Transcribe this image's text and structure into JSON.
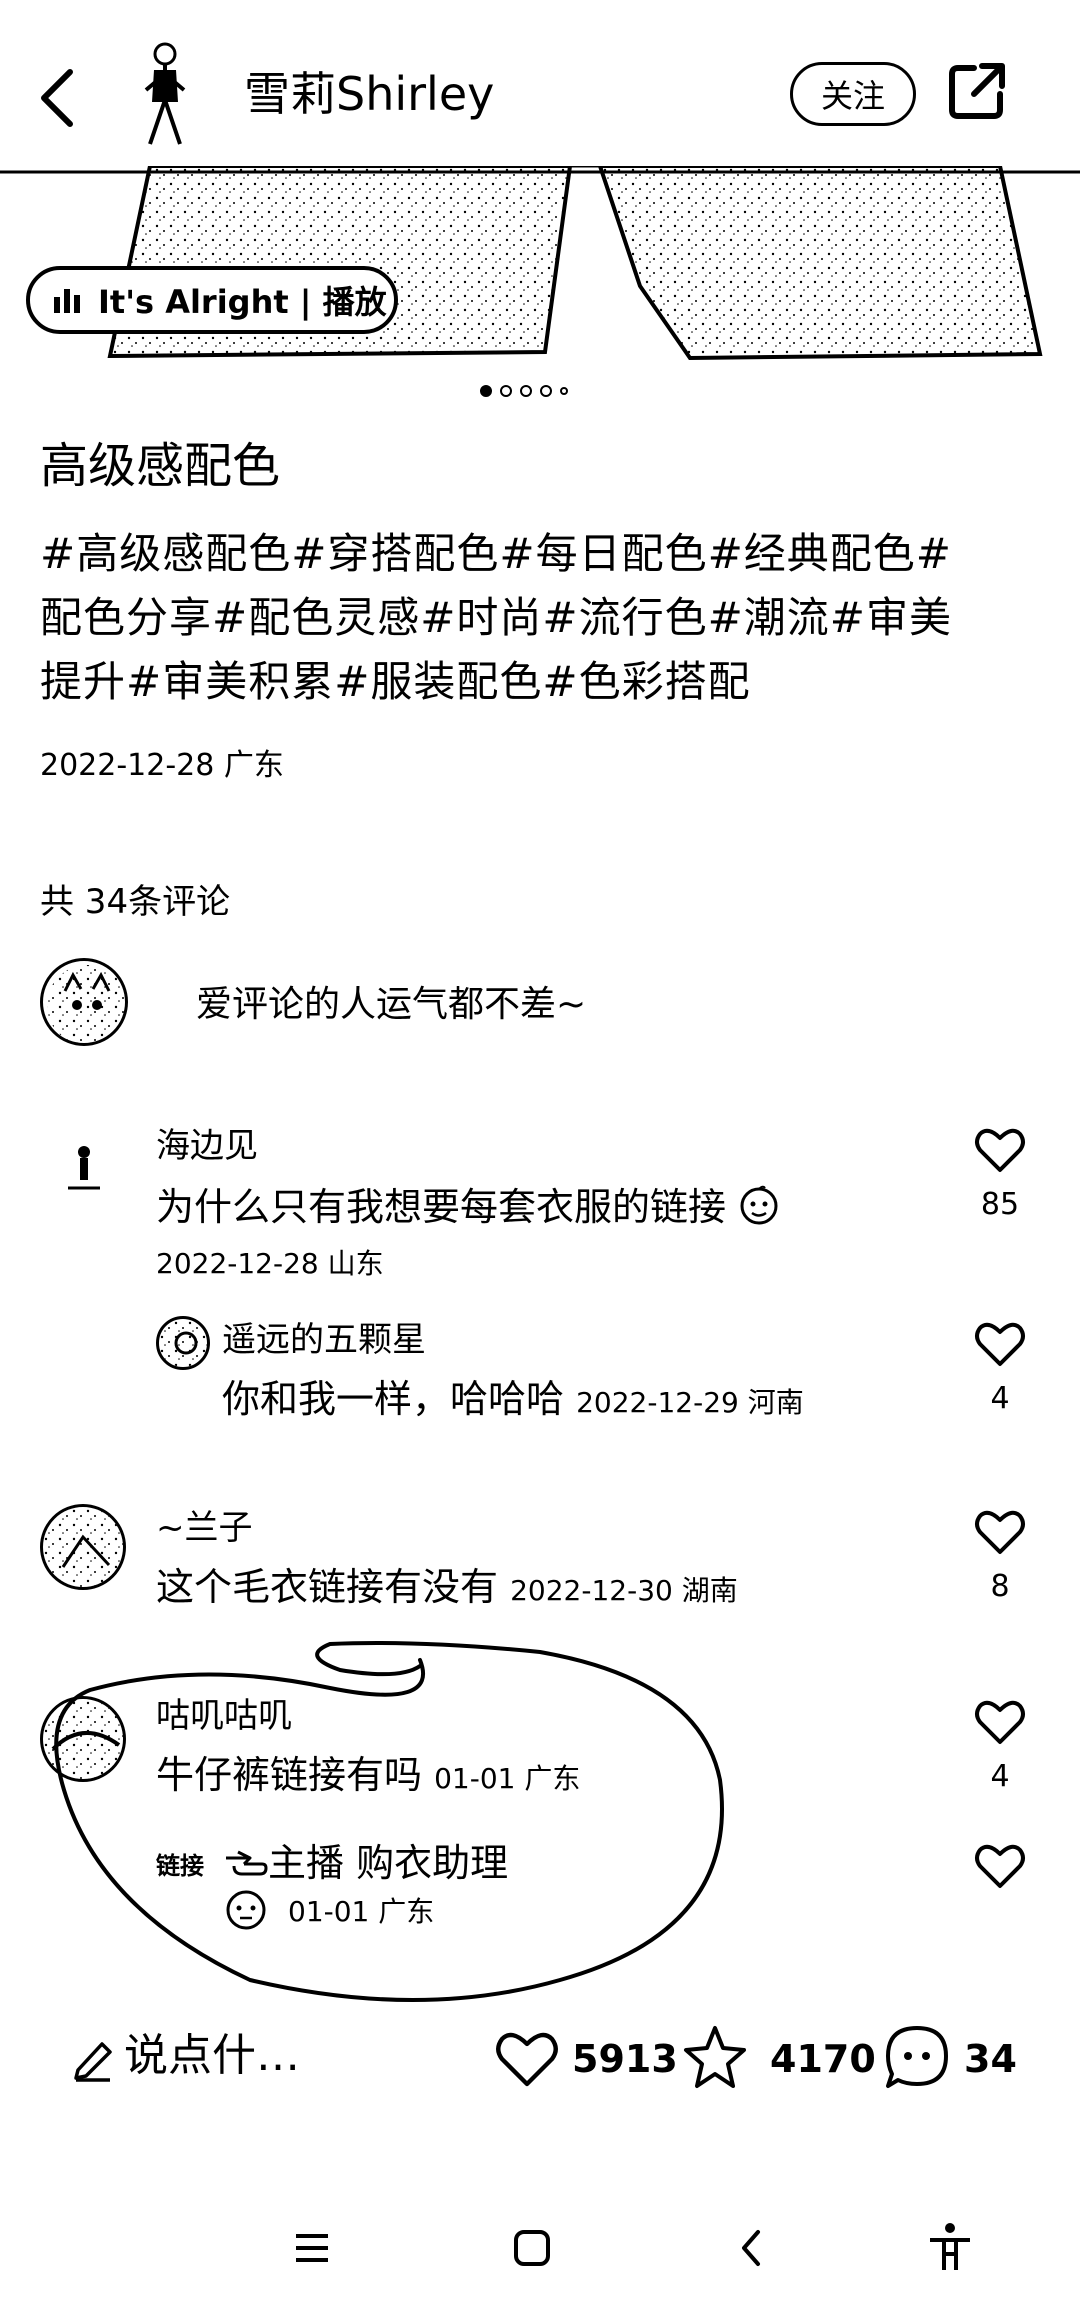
{
  "header": {
    "author_name": "雪莉Shirley",
    "follow_label": "关注"
  },
  "music": {
    "label": "It's Alright | 播放"
  },
  "carousel": {
    "count": 5,
    "active_index": 0
  },
  "post": {
    "title": "高级感配色",
    "tags_line1": "#高级感配色#穿搭配色#每日配色#经典配色#",
    "tags_line2": "配色分享#配色灵感#时尚#流行色#潮流#审美",
    "tags_line3": "提升#审美积累#服装配色#色彩搭配",
    "date_location": "2022-12-28 广东"
  },
  "comments_section": {
    "count_label": "共 34条评论",
    "prompt": "爱评论的人运气都不差~"
  },
  "comments": [
    {
      "name": "海边见",
      "text": "为什么只有我想要每套衣服的链接",
      "meta": "2022-12-28 山东",
      "likes": "85"
    },
    {
      "name": "遥远的五颗星",
      "text": "你和我一样，哈哈哈",
      "meta": "2022-12-29 河南",
      "likes": "4"
    },
    {
      "name": "~兰子",
      "text": "这个毛衣链接有没有",
      "meta": "2022-12-30 湖南",
      "likes": "8"
    },
    {
      "name": "咕叽咕叽",
      "text": "牛仔裤链接有吗",
      "meta": "01-01 广东",
      "likes": "4"
    },
    {
      "name": "链接",
      "text": "主播 购衣助理",
      "meta": "01-01 广东",
      "likes": ""
    }
  ],
  "bottom_bar": {
    "input_placeholder": "说点什…",
    "likes": "5913",
    "favorites": "4170",
    "comments": "34"
  },
  "icons": {
    "back": "chevron-left-icon",
    "share": "share-icon",
    "like": "heart-icon",
    "favorite": "star-icon",
    "comment": "chat-bubble-icon",
    "edit": "pen-icon"
  }
}
